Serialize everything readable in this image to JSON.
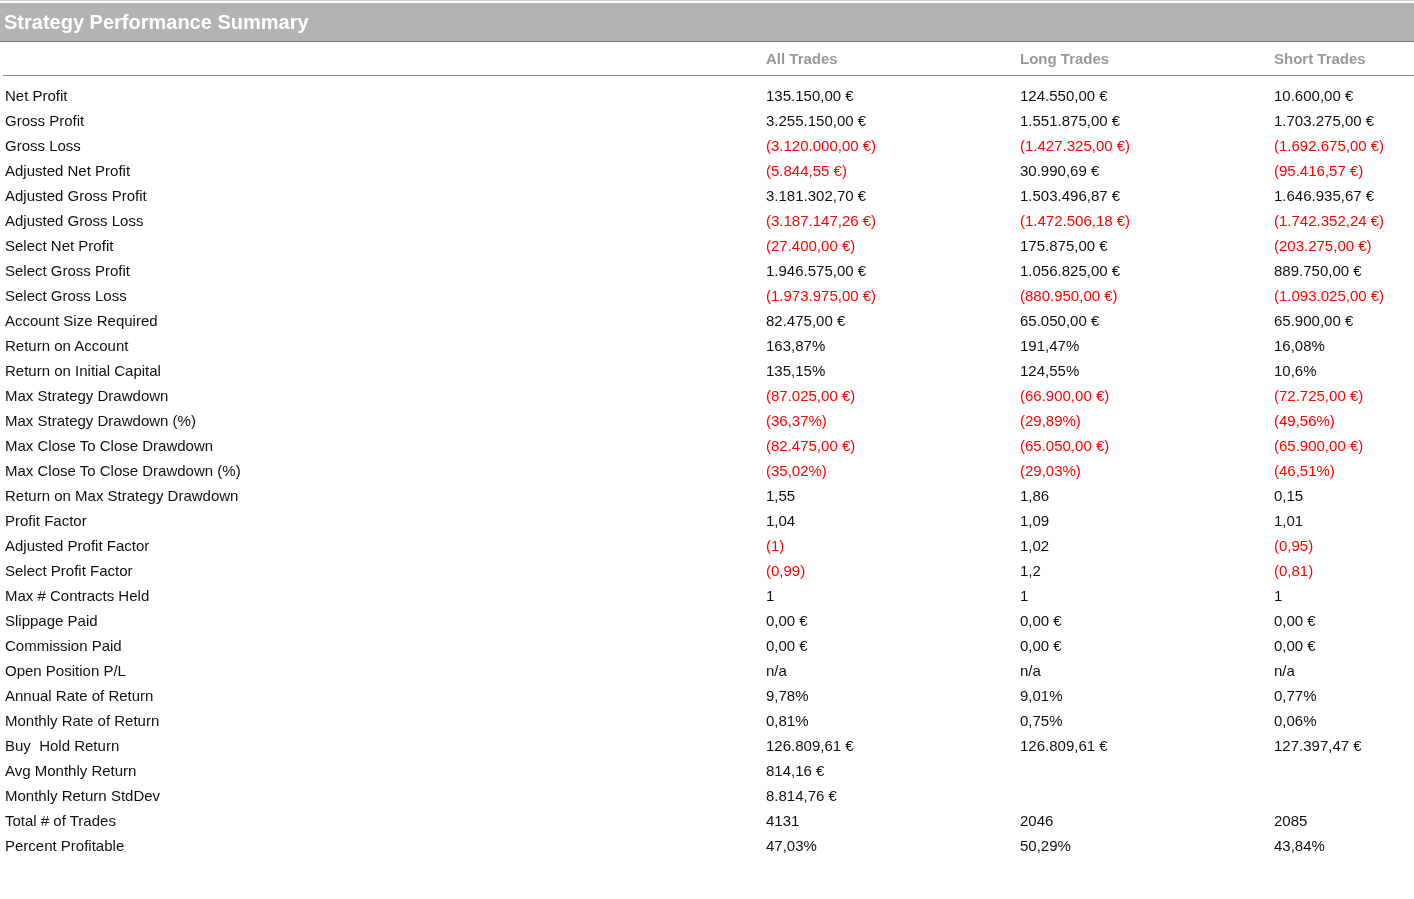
{
  "title": "Strategy Performance Summary",
  "columns": [
    "All Trades",
    "Long Trades",
    "Short Trades"
  ],
  "rows": [
    {
      "label": "Net Profit",
      "values": [
        {
          "text": "135.150,00 €",
          "negative": false
        },
        {
          "text": "124.550,00 €",
          "negative": false
        },
        {
          "text": "10.600,00 €",
          "negative": false
        }
      ]
    },
    {
      "label": "Gross Profit",
      "values": [
        {
          "text": "3.255.150,00 €",
          "negative": false
        },
        {
          "text": "1.551.875,00 €",
          "negative": false
        },
        {
          "text": "1.703.275,00 €",
          "negative": false
        }
      ]
    },
    {
      "label": "Gross Loss",
      "values": [
        {
          "text": "(3.120.000,00 €)",
          "negative": true
        },
        {
          "text": "(1.427.325,00 €)",
          "negative": true
        },
        {
          "text": "(1.692.675,00 €)",
          "negative": true
        }
      ]
    },
    {
      "label": "Adjusted Net Profit",
      "values": [
        {
          "text": "(5.844,55 €)",
          "negative": true
        },
        {
          "text": "30.990,69 €",
          "negative": false
        },
        {
          "text": "(95.416,57 €)",
          "negative": true
        }
      ]
    },
    {
      "label": "Adjusted Gross Profit",
      "values": [
        {
          "text": "3.181.302,70 €",
          "negative": false
        },
        {
          "text": "1.503.496,87 €",
          "negative": false
        },
        {
          "text": "1.646.935,67 €",
          "negative": false
        }
      ]
    },
    {
      "label": "Adjusted Gross Loss",
      "values": [
        {
          "text": "(3.187.147,26 €)",
          "negative": true
        },
        {
          "text": "(1.472.506,18 €)",
          "negative": true
        },
        {
          "text": "(1.742.352,24 €)",
          "negative": true
        }
      ]
    },
    {
      "label": "Select Net Profit",
      "values": [
        {
          "text": "(27.400,00 €)",
          "negative": true
        },
        {
          "text": "175.875,00 €",
          "negative": false
        },
        {
          "text": "(203.275,00 €)",
          "negative": true
        }
      ]
    },
    {
      "label": "Select Gross Profit",
      "values": [
        {
          "text": "1.946.575,00 €",
          "negative": false
        },
        {
          "text": "1.056.825,00 €",
          "negative": false
        },
        {
          "text": "889.750,00 €",
          "negative": false
        }
      ]
    },
    {
      "label": "Select Gross Loss",
      "values": [
        {
          "text": "(1.973.975,00 €)",
          "negative": true
        },
        {
          "text": "(880.950,00 €)",
          "negative": true
        },
        {
          "text": "(1.093.025,00 €)",
          "negative": true
        }
      ]
    },
    {
      "label": "Account Size Required",
      "values": [
        {
          "text": "82.475,00 €",
          "negative": false
        },
        {
          "text": "65.050,00 €",
          "negative": false
        },
        {
          "text": "65.900,00 €",
          "negative": false
        }
      ]
    },
    {
      "label": "Return on Account",
      "values": [
        {
          "text": "163,87%",
          "negative": false
        },
        {
          "text": "191,47%",
          "negative": false
        },
        {
          "text": "16,08%",
          "negative": false
        }
      ]
    },
    {
      "label": "Return on Initial Capital",
      "values": [
        {
          "text": "135,15%",
          "negative": false
        },
        {
          "text": "124,55%",
          "negative": false
        },
        {
          "text": "10,6%",
          "negative": false
        }
      ]
    },
    {
      "label": "Max Strategy Drawdown",
      "values": [
        {
          "text": "(87.025,00 €)",
          "negative": true
        },
        {
          "text": "(66.900,00 €)",
          "negative": true
        },
        {
          "text": "(72.725,00 €)",
          "negative": true
        }
      ]
    },
    {
      "label": "Max Strategy Drawdown (%)",
      "values": [
        {
          "text": "(36,37%)",
          "negative": true
        },
        {
          "text": "(29,89%)",
          "negative": true
        },
        {
          "text": "(49,56%)",
          "negative": true
        }
      ]
    },
    {
      "label": "Max Close To Close Drawdown",
      "values": [
        {
          "text": "(82.475,00 €)",
          "negative": true
        },
        {
          "text": "(65.050,00 €)",
          "negative": true
        },
        {
          "text": "(65.900,00 €)",
          "negative": true
        }
      ]
    },
    {
      "label": "Max Close To Close Drawdown (%)",
      "values": [
        {
          "text": "(35,02%)",
          "negative": true
        },
        {
          "text": "(29,03%)",
          "negative": true
        },
        {
          "text": "(46,51%)",
          "negative": true
        }
      ]
    },
    {
      "label": "Return on Max Strategy Drawdown",
      "values": [
        {
          "text": "1,55",
          "negative": false
        },
        {
          "text": "1,86",
          "negative": false
        },
        {
          "text": "0,15",
          "negative": false
        }
      ]
    },
    {
      "label": "Profit Factor",
      "values": [
        {
          "text": "1,04",
          "negative": false
        },
        {
          "text": "1,09",
          "negative": false
        },
        {
          "text": "1,01",
          "negative": false
        }
      ]
    },
    {
      "label": "Adjusted Profit Factor",
      "values": [
        {
          "text": "(1)",
          "negative": true
        },
        {
          "text": "1,02",
          "negative": false
        },
        {
          "text": "(0,95)",
          "negative": true
        }
      ]
    },
    {
      "label": "Select Profit Factor",
      "values": [
        {
          "text": "(0,99)",
          "negative": true
        },
        {
          "text": "1,2",
          "negative": false
        },
        {
          "text": "(0,81)",
          "negative": true
        }
      ]
    },
    {
      "label": "Max # Contracts Held",
      "values": [
        {
          "text": "1",
          "negative": false
        },
        {
          "text": "1",
          "negative": false
        },
        {
          "text": "1",
          "negative": false
        }
      ]
    },
    {
      "label": "Slippage Paid",
      "values": [
        {
          "text": "0,00 €",
          "negative": false
        },
        {
          "text": "0,00 €",
          "negative": false
        },
        {
          "text": "0,00 €",
          "negative": false
        }
      ]
    },
    {
      "label": "Commission Paid",
      "values": [
        {
          "text": "0,00 €",
          "negative": false
        },
        {
          "text": "0,00 €",
          "negative": false
        },
        {
          "text": "0,00 €",
          "negative": false
        }
      ]
    },
    {
      "label": "Open Position P/L",
      "values": [
        {
          "text": "n/a",
          "negative": false
        },
        {
          "text": "n/a",
          "negative": false
        },
        {
          "text": "n/a",
          "negative": false
        }
      ]
    },
    {
      "label": "Annual Rate of Return",
      "values": [
        {
          "text": "9,78%",
          "negative": false
        },
        {
          "text": "9,01%",
          "negative": false
        },
        {
          "text": "0,77%",
          "negative": false
        }
      ]
    },
    {
      "label": "Monthly Rate of Return",
      "values": [
        {
          "text": "0,81%",
          "negative": false
        },
        {
          "text": "0,75%",
          "negative": false
        },
        {
          "text": "0,06%",
          "negative": false
        }
      ]
    },
    {
      "label": "Buy  Hold Return",
      "values": [
        {
          "text": "126.809,61 €",
          "negative": false
        },
        {
          "text": "126.809,61 €",
          "negative": false
        },
        {
          "text": "127.397,47 €",
          "negative": false
        }
      ]
    },
    {
      "label": "Avg Monthly Return",
      "values": [
        {
          "text": "814,16 €",
          "negative": false
        }
      ]
    },
    {
      "label": "Monthly Return StdDev",
      "values": [
        {
          "text": "8.814,76 €",
          "negative": false
        }
      ]
    },
    {
      "label": "Total # of Trades",
      "values": [
        {
          "text": "4131",
          "negative": false
        },
        {
          "text": "2046",
          "negative": false
        },
        {
          "text": "2085",
          "negative": false
        }
      ]
    },
    {
      "label": "Percent Profitable",
      "values": [
        {
          "text": "47,03%",
          "negative": false
        },
        {
          "text": "50,29%",
          "negative": false
        },
        {
          "text": "43,84%",
          "negative": false
        }
      ]
    }
  ]
}
